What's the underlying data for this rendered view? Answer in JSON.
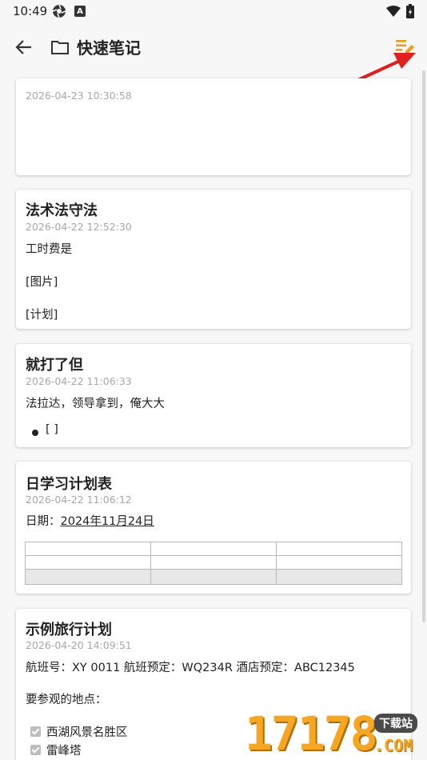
{
  "status_bar": {
    "time": "10:49",
    "icon_a": "A"
  },
  "app_bar": {
    "title": "快速笔记"
  },
  "notes": [
    {
      "title": "",
      "time": "2026-04-23 10:30:58"
    },
    {
      "title": "法术法守法",
      "time": "2026-04-22 12:52:30",
      "lines": [
        "工时费是",
        "[图片]",
        "[计划]"
      ]
    },
    {
      "title": "就打了但",
      "time": "2026-04-22 11:06:33",
      "lines": [
        "法拉达，领导拿到，俺大大"
      ],
      "bullet_text": "[ ]"
    },
    {
      "title": "日学习计划表",
      "time": "2026-04-22 11:06:12",
      "date_label": "日期：",
      "date_value": "2024年11月24日"
    },
    {
      "title": "示例旅行计划",
      "time": "2026-04-20 14:09:51",
      "lines": [
        "航班号：XY 0011 航班预定：WQ234R 酒店预定：ABC12345",
        "要参观的地点："
      ],
      "checklist": [
        "西湖风景名胜区",
        "雷峰塔"
      ]
    }
  ],
  "watermark": {
    "number": "17178",
    "tag": "下载站",
    "suffix": ".COM"
  },
  "colors": {
    "accent": "#f39c12",
    "annotation": "#e02020"
  }
}
